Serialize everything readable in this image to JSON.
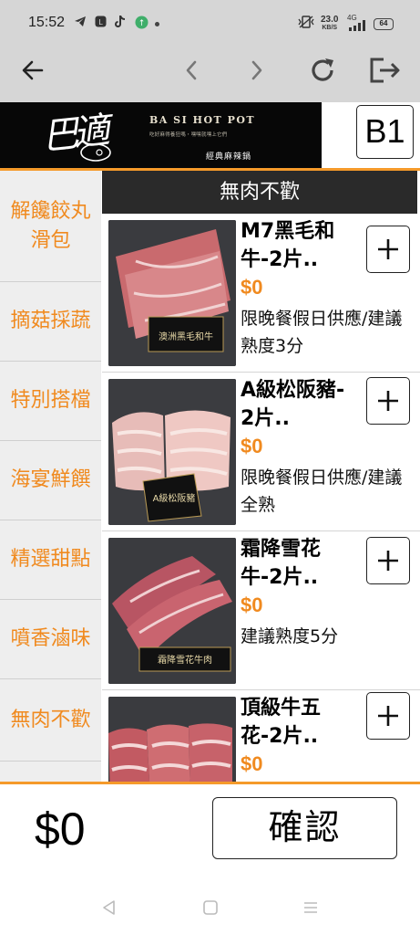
{
  "status_bar": {
    "time": "15:52",
    "speed_value": "23.0",
    "speed_unit": "KB/S",
    "network": "4G",
    "battery": "64",
    "icons": [
      "telegram-icon",
      "line-icon",
      "tiktok-icon",
      "app-icon",
      "notification-dot",
      "vibrate-icon",
      "signal-icon"
    ]
  },
  "browser_toolbar": {
    "icons": [
      "back-arrow-icon",
      "history-back-icon",
      "history-forward-icon",
      "reload-icon",
      "exit-icon"
    ]
  },
  "header": {
    "logo_script": "巴適",
    "brand_en": "BA SI HOT POT",
    "brand_sub": "吃好麻得養狂嗎・嘿嘿就嘿上它們",
    "brand_cn": "經典麻辣鍋",
    "table_number": "B1"
  },
  "sidebar": {
    "categories": [
      {
        "label": "解饞餃丸滑包"
      },
      {
        "label": "摘菇採蔬"
      },
      {
        "label": "特別搭檔"
      },
      {
        "label": "海宴鮮饌"
      },
      {
        "label": "精選甜點"
      },
      {
        "label": "噴香滷味"
      },
      {
        "label": "無肉不歡"
      }
    ]
  },
  "main": {
    "section_title": "無肉不歡",
    "items": [
      {
        "name": "M7黑毛和牛-2片..",
        "price": "$0",
        "note": "限晚餐假日供應/建議熟度3分",
        "image_label": "澳洲黑毛和牛"
      },
      {
        "name": "A級松阪豬- 2片..",
        "price": "$0",
        "note": "限晚餐假日供應/建議全熟",
        "image_label": "A級松阪豬"
      },
      {
        "name": "霜降雪花牛-2片..",
        "price": "$0",
        "note": "建議熟度5分",
        "image_label": "霜降雪花牛肉"
      },
      {
        "name": "頂級牛五花-2片..",
        "price": "$0",
        "note": "",
        "image_label": ""
      }
    ],
    "add_button_label": "+"
  },
  "footer": {
    "total": "$0",
    "confirm_label": "確認"
  },
  "colors": {
    "accent": "#f08a1f",
    "header_bg": "#070707",
    "section_title_bg": "#2a2a2a",
    "sidebar_bg": "#eeeeee",
    "browser_bar_bg": "#d6d6d6"
  }
}
